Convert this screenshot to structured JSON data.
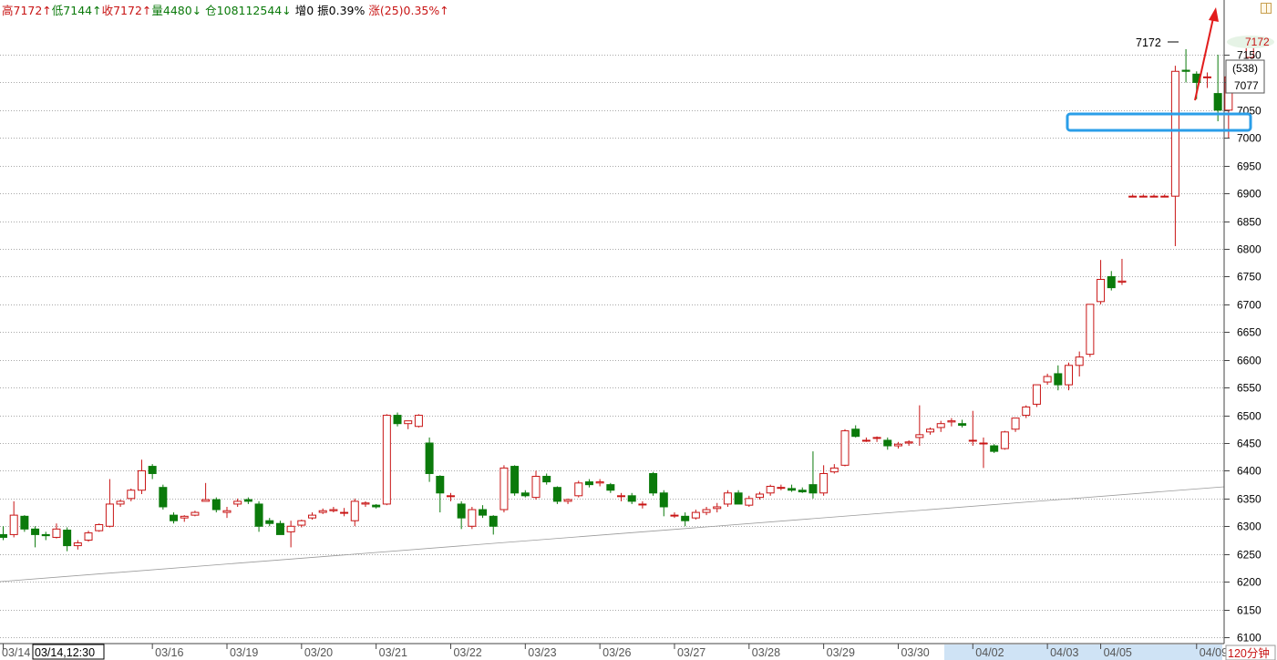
{
  "header": {
    "high": "高7172↑",
    "low": "低7144↑",
    "close": "收7172↑",
    "volume": "量4480↓",
    "open_interest": "仓108112544↓",
    "oi_change": "增0",
    "amplitude": "振0.39%",
    "change": "涨(25)0.35%↑"
  },
  "price_panel": {
    "current_price": "7172",
    "count": "(538)",
    "low_mark": "7077",
    "peak_label": "7172",
    "period": "120分钟"
  },
  "colors": {
    "up": "#c81414",
    "down": "#0b7a0b",
    "grid": "#8c8c8c",
    "highlight_box": "#2a9ee8",
    "arrow": "#e21c1c"
  },
  "chart_data": {
    "type": "candlestick",
    "y_axis": {
      "min": 6100,
      "max": 7150,
      "ticks": [
        6100,
        6150,
        6200,
        6250,
        6300,
        6350,
        6400,
        6450,
        6500,
        6550,
        6600,
        6650,
        6700,
        6750,
        6800,
        6850,
        6900,
        6950,
        7000,
        7050,
        7100,
        7150
      ]
    },
    "x_axis": {
      "cursor_label": "03/14,12:30",
      "labels": [
        {
          "text": "03/14",
          "index": 0
        },
        {
          "text": "03/16",
          "index": 14
        },
        {
          "text": "03/19",
          "index": 21
        },
        {
          "text": "03/20",
          "index": 28
        },
        {
          "text": "03/21",
          "index": 35
        },
        {
          "text": "03/22",
          "index": 42
        },
        {
          "text": "03/23",
          "index": 49
        },
        {
          "text": "03/26",
          "index": 56
        },
        {
          "text": "03/27",
          "index": 63
        },
        {
          "text": "03/28",
          "index": 70
        },
        {
          "text": "03/29",
          "index": 77
        },
        {
          "text": "03/30",
          "index": 84
        },
        {
          "text": "04/02",
          "index": 91
        },
        {
          "text": "04/03",
          "index": 98
        },
        {
          "text": "04/05",
          "index": 103
        },
        {
          "text": "04/09",
          "index": 112
        }
      ]
    },
    "candles": [
      [
        6285,
        6300,
        6275,
        6280
      ],
      [
        6285,
        6345,
        6280,
        6320
      ],
      [
        6318,
        6320,
        6290,
        6295
      ],
      [
        6295,
        6300,
        6262,
        6285
      ],
      [
        6285,
        6290,
        6275,
        6283
      ],
      [
        6280,
        6305,
        6278,
        6295
      ],
      [
        6293,
        6298,
        6255,
        6265
      ],
      [
        6265,
        6275,
        6258,
        6270
      ],
      [
        6275,
        6292,
        6272,
        6288
      ],
      [
        6292,
        6305,
        6290,
        6303
      ],
      [
        6300,
        6385,
        6298,
        6340
      ],
      [
        6340,
        6348,
        6335,
        6345
      ],
      [
        6350,
        6368,
        6345,
        6365
      ],
      [
        6365,
        6420,
        6358,
        6400
      ],
      [
        6408,
        6412,
        6385,
        6395
      ],
      [
        6370,
        6375,
        6330,
        6335
      ],
      [
        6320,
        6325,
        6305,
        6310
      ],
      [
        6315,
        6320,
        6308,
        6318
      ],
      [
        6320,
        6328,
        6318,
        6325
      ],
      [
        6345,
        6378,
        6345,
        6348
      ],
      [
        6348,
        6352,
        6325,
        6330
      ],
      [
        6325,
        6335,
        6315,
        6328
      ],
      [
        6340,
        6350,
        6335,
        6345
      ],
      [
        6348,
        6352,
        6340,
        6345
      ],
      [
        6340,
        6345,
        6290,
        6300
      ],
      [
        6310,
        6315,
        6300,
        6305
      ],
      [
        6305,
        6310,
        6285,
        6285
      ],
      [
        6290,
        6310,
        6262,
        6300
      ],
      [
        6302,
        6312,
        6298,
        6310
      ],
      [
        6315,
        6325,
        6312,
        6320
      ],
      [
        6325,
        6332,
        6322,
        6328
      ],
      [
        6328,
        6335,
        6325,
        6330
      ],
      [
        6325,
        6333,
        6318,
        6325
      ],
      [
        6310,
        6350,
        6300,
        6345
      ],
      [
        6340,
        6345,
        6335,
        6342
      ],
      [
        6338,
        6340,
        6332,
        6335
      ],
      [
        6340,
        6502,
        6338,
        6500
      ],
      [
        6500,
        6505,
        6480,
        6485
      ],
      [
        6485,
        6490,
        6475,
        6490
      ],
      [
        6480,
        6502,
        6478,
        6500
      ],
      [
        6450,
        6460,
        6380,
        6395
      ],
      [
        6390,
        6392,
        6325,
        6360
      ],
      [
        6355,
        6360,
        6345,
        6355
      ],
      [
        6340,
        6345,
        6295,
        6315
      ],
      [
        6300,
        6335,
        6295,
        6330
      ],
      [
        6330,
        6338,
        6315,
        6320
      ],
      [
        6318,
        6320,
        6285,
        6300
      ],
      [
        6330,
        6410,
        6325,
        6405
      ],
      [
        6408,
        6410,
        6355,
        6360
      ],
      [
        6360,
        6365,
        6352,
        6355
      ],
      [
        6352,
        6400,
        6348,
        6390
      ],
      [
        6390,
        6395,
        6375,
        6380
      ],
      [
        6370,
        6372,
        6340,
        6345
      ],
      [
        6345,
        6350,
        6340,
        6348
      ],
      [
        6355,
        6382,
        6352,
        6378
      ],
      [
        6380,
        6385,
        6370,
        6375
      ],
      [
        6378,
        6385,
        6372,
        6380
      ],
      [
        6375,
        6378,
        6360,
        6365
      ],
      [
        6355,
        6360,
        6345,
        6355
      ],
      [
        6355,
        6360,
        6340,
        6345
      ],
      [
        6340,
        6345,
        6332,
        6340
      ],
      [
        6395,
        6398,
        6355,
        6360
      ],
      [
        6360,
        6365,
        6318,
        6335
      ],
      [
        6320,
        6325,
        6315,
        6320
      ],
      [
        6318,
        6325,
        6300,
        6310
      ],
      [
        6315,
        6330,
        6312,
        6325
      ],
      [
        6325,
        6335,
        6320,
        6330
      ],
      [
        6332,
        6342,
        6325,
        6335
      ],
      [
        6340,
        6365,
        6335,
        6360
      ],
      [
        6360,
        6365,
        6340,
        6340
      ],
      [
        6338,
        6355,
        6335,
        6350
      ],
      [
        6352,
        6362,
        6348,
        6358
      ],
      [
        6360,
        6375,
        6355,
        6372
      ],
      [
        6370,
        6375,
        6365,
        6370
      ],
      [
        6368,
        6375,
        6362,
        6365
      ],
      [
        6365,
        6370,
        6360,
        6362
      ],
      [
        6375,
        6435,
        6350,
        6360
      ],
      [
        6360,
        6410,
        6355,
        6395
      ],
      [
        6398,
        6412,
        6395,
        6405
      ],
      [
        6410,
        6475,
        6408,
        6472
      ],
      [
        6475,
        6482,
        6460,
        6462
      ],
      [
        6455,
        6460,
        6452,
        6455
      ],
      [
        6460,
        6462,
        6452,
        6460
      ],
      [
        6455,
        6460,
        6438,
        6445
      ],
      [
        6445,
        6452,
        6440,
        6448
      ],
      [
        6450,
        6455,
        6445,
        6452
      ],
      [
        6460,
        6518,
        6445,
        6465
      ],
      [
        6470,
        6478,
        6465,
        6475
      ],
      [
        6478,
        6490,
        6470,
        6485
      ],
      [
        6488,
        6495,
        6480,
        6490
      ],
      [
        6485,
        6492,
        6478,
        6482
      ],
      [
        6455,
        6508,
        6445,
        6455
      ],
      [
        6450,
        6460,
        6405,
        6450
      ],
      [
        6445,
        6448,
        6432,
        6435
      ],
      [
        6440,
        6472,
        6438,
        6470
      ],
      [
        6475,
        6495,
        6470,
        6495
      ],
      [
        6500,
        6518,
        6495,
        6515
      ],
      [
        6520,
        6555,
        6515,
        6555
      ],
      [
        6560,
        6575,
        6555,
        6570
      ],
      [
        6575,
        6590,
        6545,
        6555
      ],
      [
        6555,
        6595,
        6545,
        6590
      ],
      [
        6590,
        6615,
        6570,
        6605
      ],
      [
        6610,
        6700,
        6605,
        6700
      ],
      [
        6705,
        6780,
        6700,
        6745
      ],
      [
        6750,
        6760,
        6725,
        6730
      ],
      [
        6740,
        6782,
        6735,
        6742
      ],
      [
        6895,
        6898,
        6893,
        6895
      ],
      [
        6895,
        6898,
        6893,
        6895
      ],
      [
        6895,
        6898,
        6893,
        6895
      ],
      [
        6895,
        6898,
        6893,
        6895
      ],
      [
        6895,
        7130,
        6805,
        7120
      ],
      [
        7122,
        7160,
        7100,
        7120
      ],
      [
        7115,
        7120,
        7070,
        7100
      ],
      [
        7110,
        7118,
        7090,
        7110
      ],
      [
        7080,
        7150,
        7030,
        7050
      ],
      [
        7050,
        7130,
        7000,
        7110
      ],
      [
        7110,
        7140,
        7105,
        7140
      ],
      [
        7145,
        7172,
        7144,
        7172
      ]
    ]
  }
}
